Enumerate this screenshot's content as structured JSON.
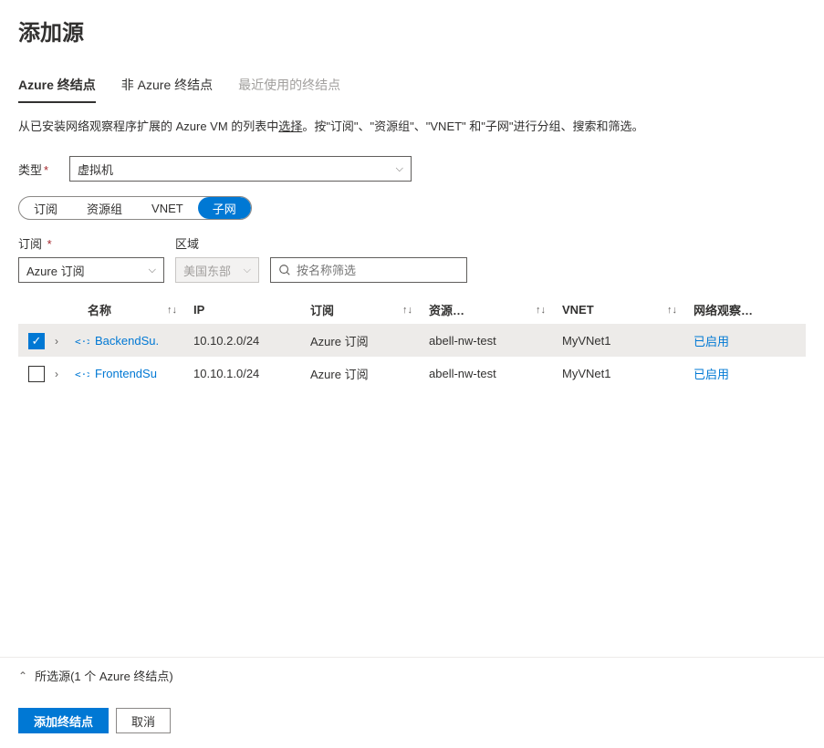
{
  "page_title": "添加源",
  "tabs": {
    "azure": "Azure 终结点",
    "non_azure": "非 Azure 终结点",
    "recent": "最近使用的终结点"
  },
  "description_prefix": "从已安装网络观察程序扩展的 Azure VM 的列表中",
  "description_select": "选择",
  "description_suffix": "。按\"订阅\"、\"资源组\"、\"VNET\" 和\"子网\"进行分组、搜索和筛选。",
  "type_label": "类型",
  "type_value": "虚拟机",
  "pills": {
    "subscription": "订阅",
    "resource_group": "资源组",
    "vnet": "VNET",
    "subnet": "子网"
  },
  "filters": {
    "subscription_label": "订阅",
    "subscription_value": "Azure 订阅",
    "region_label": "区域",
    "region_value": "美国东部",
    "search_placeholder": "按名称筛选"
  },
  "headers": {
    "name": "名称",
    "ip": "IP",
    "subscription": "订阅",
    "resource": "资源…",
    "vnet": "VNET",
    "network_watcher": "网络观察…"
  },
  "rows": [
    {
      "checked": true,
      "name": "BackendSu.",
      "ip": "10.10.2.0/24",
      "subscription": "Azure 订阅",
      "resource_group": "abell-nw-test",
      "vnet": "MyVNet1",
      "nw_status": "已启用"
    },
    {
      "checked": false,
      "name": "FrontendSu",
      "ip": "10.10.1.0/24",
      "subscription": "Azure 订阅",
      "resource_group": "abell-nw-test",
      "vnet": "MyVNet1",
      "nw_status": "已启用"
    }
  ],
  "selected_summary": "所选源(1 个 Azure 终结点)",
  "buttons": {
    "add": "添加终结点",
    "cancel": "取消"
  }
}
